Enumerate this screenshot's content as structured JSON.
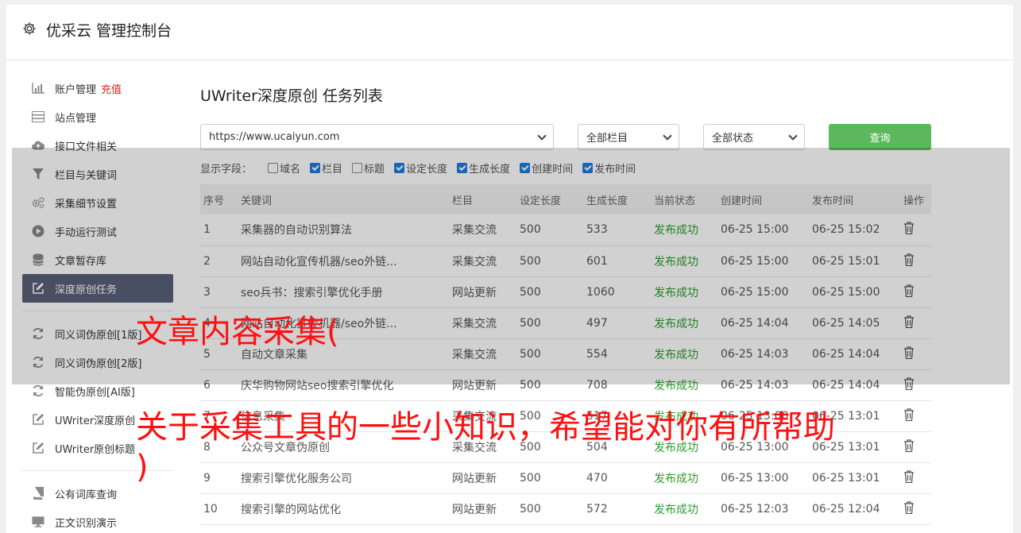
{
  "header": {
    "title": "优采云 管理控制台",
    "icon": "gear-icon"
  },
  "sidebar": {
    "items": [
      {
        "label": "账户管理",
        "tag": "充值",
        "icon": "bar-chart-icon"
      },
      {
        "label": "站点管理",
        "icon": "server-icon"
      },
      {
        "label": "接口文件相关",
        "icon": "cloud-upload-icon"
      },
      {
        "label": "栏目与关键词",
        "icon": "filter-icon"
      },
      {
        "label": "采集细节设置",
        "icon": "cogs-icon"
      },
      {
        "label": "手动运行测试",
        "icon": "play-icon"
      },
      {
        "label": "文章暂存库",
        "icon": "database-icon"
      },
      {
        "label": "深度原创任务",
        "icon": "edit-icon",
        "active": true
      }
    ],
    "items2": [
      {
        "label": "同义词伪原创[1版]",
        "icon": "refresh-icon"
      },
      {
        "label": "同义词伪原创[2版]",
        "icon": "refresh-icon"
      },
      {
        "label": "智能伪原创[AI版]",
        "icon": "refresh-icon"
      },
      {
        "label": "UWriter深度原创",
        "icon": "edit-icon"
      },
      {
        "label": "UWriter原创标题",
        "icon": "edit-icon"
      }
    ],
    "items3": [
      {
        "label": "公有词库查询",
        "icon": "book-icon"
      },
      {
        "label": "正文识别演示",
        "icon": "monitor-icon"
      }
    ]
  },
  "main": {
    "title": "UWriter深度原创 任务列表",
    "site_select": "https://www.ucaiyun.com",
    "column_select": "全部栏目",
    "status_select": "全部状态",
    "query_label": "查询",
    "fields_label": "显示字段：",
    "fields": [
      {
        "label": "域名",
        "checked": false
      },
      {
        "label": "栏目",
        "checked": true
      },
      {
        "label": "标题",
        "checked": false
      },
      {
        "label": "设定长度",
        "checked": true
      },
      {
        "label": "生成长度",
        "checked": true
      },
      {
        "label": "创建时间",
        "checked": true
      },
      {
        "label": "发布时间",
        "checked": true
      }
    ],
    "columns": [
      "序号",
      "关键词",
      "栏目",
      "设定长度",
      "生成长度",
      "当前状态",
      "创建时间",
      "发布时间",
      "操作"
    ],
    "rows": [
      [
        "1",
        "采集器的自动识别算法",
        "采集交流",
        "500",
        "533",
        "发布成功",
        "06-25 15:00",
        "06-25 15:02"
      ],
      [
        "2",
        "网站自动化宣传机器/seo外链...",
        "采集交流",
        "500",
        "601",
        "发布成功",
        "06-25 15:00",
        "06-25 15:01"
      ],
      [
        "3",
        "seo兵书：搜索引擎优化手册",
        "网站更新",
        "500",
        "1060",
        "发布成功",
        "06-25 15:00",
        "06-25 15:00"
      ],
      [
        "4",
        "网站自动化宣传机器/seo外链...",
        "采集交流",
        "500",
        "497",
        "发布成功",
        "06-25 14:04",
        "06-25 14:05"
      ],
      [
        "5",
        "自动文章采集",
        "采集交流",
        "500",
        "554",
        "发布成功",
        "06-25 14:03",
        "06-25 14:04"
      ],
      [
        "6",
        "庆华购物网站seo搜索引擎优化",
        "网站更新",
        "500",
        "708",
        "发布成功",
        "06-25 14:03",
        "06-25 14:04"
      ],
      [
        "7",
        "信息采集",
        "采集交流",
        "500",
        "517",
        "发布成功",
        "06-25 13:00",
        "06-25 13:01"
      ],
      [
        "8",
        "公众号文章伪原创",
        "采集交流",
        "500",
        "504",
        "发布成功",
        "06-25 13:00",
        "06-25 13:01"
      ],
      [
        "9",
        "搜索引擎优化服务公司",
        "网站更新",
        "500",
        "470",
        "发布成功",
        "06-25 13:00",
        "06-25 13:01"
      ],
      [
        "10",
        "搜索引擎的网站优化",
        "网站更新",
        "500",
        "572",
        "发布成功",
        "06-25 12:03",
        "06-25 12:04"
      ]
    ],
    "action_icon": "trash-icon"
  },
  "watermark": {
    "line1": "文章内容采集(",
    "line2": "关于采集工具的一些小知识，希望能对你有所帮助",
    "line3": ")"
  },
  "colors": {
    "accent": "#5cb85c",
    "active_nav": "#5a6178",
    "status_ok": "#2a9d2a",
    "recharge": "#e02020",
    "watermark": "#ff1010"
  }
}
